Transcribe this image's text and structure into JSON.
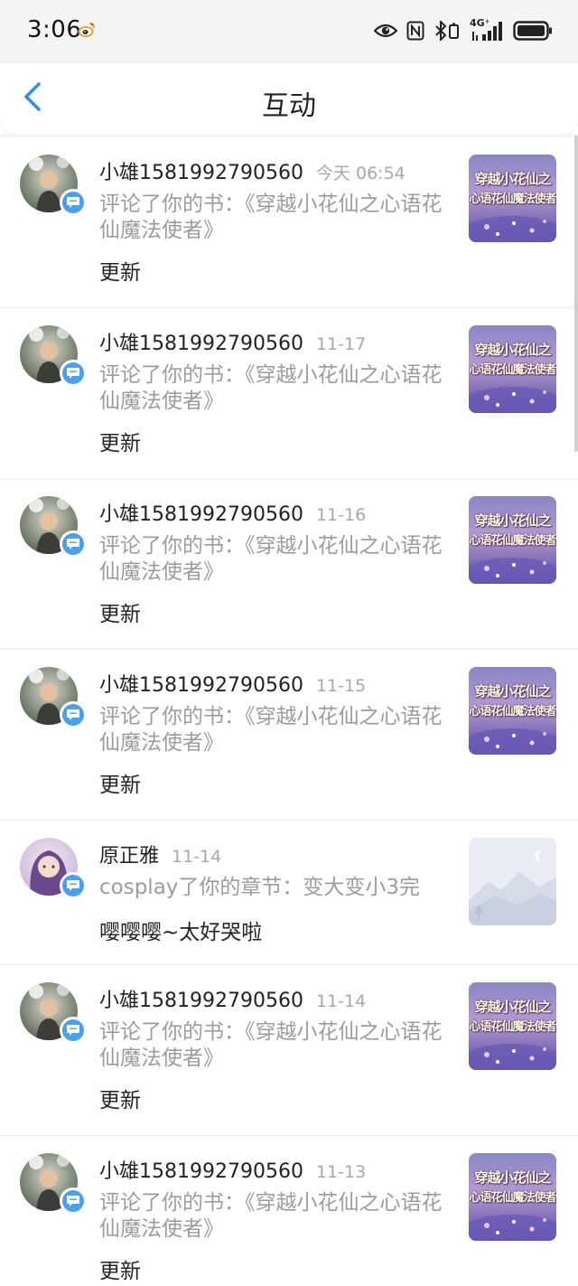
{
  "status_bar": {
    "time": "3:06",
    "network": "4G⁺"
  },
  "header": {
    "title": "互动"
  },
  "items": [
    {
      "name": "小雄1581992790560",
      "date": "今天 06:54",
      "text": "评论了你的书：《穿越小花仙之心语花仙魔法使者》",
      "reply": "更新",
      "thumb_title_1": "穿越小花仙之",
      "thumb_title_2": "心语花仙魔法使者"
    },
    {
      "name": "小雄1581992790560",
      "date": "11-17",
      "text": "评论了你的书：《穿越小花仙之心语花仙魔法使者》",
      "reply": "更新",
      "thumb_title_1": "穿越小花仙之",
      "thumb_title_2": "心语花仙魔法使者"
    },
    {
      "name": "小雄1581992790560",
      "date": "11-16",
      "text": "评论了你的书：《穿越小花仙之心语花仙魔法使者》",
      "reply": "更新",
      "thumb_title_1": "穿越小花仙之",
      "thumb_title_2": "心语花仙魔法使者"
    },
    {
      "name": "小雄1581992790560",
      "date": "11-15",
      "text": "评论了你的书：《穿越小花仙之心语花仙魔法使者》",
      "reply": "更新",
      "thumb_title_1": "穿越小花仙之",
      "thumb_title_2": "心语花仙魔法使者"
    },
    {
      "name": "原正雅",
      "date": "11-14",
      "text": "cosplay了你的章节：变大变小3完",
      "reply": "嘤嘤嘤~太好哭啦"
    },
    {
      "name": "小雄1581992790560",
      "date": "11-14",
      "text": "评论了你的书：《穿越小花仙之心语花仙魔法使者》",
      "reply": "更新",
      "thumb_title_1": "穿越小花仙之",
      "thumb_title_2": "心语花仙魔法使者"
    },
    {
      "name": "小雄1581992790560",
      "date": "11-13",
      "text": "评论了你的书：《穿越小花仙之心语花仙魔法使者》",
      "reply": "更新",
      "thumb_title_1": "穿越小花仙之",
      "thumb_title_2": "心语花仙魔法使者"
    }
  ],
  "colors": {
    "accent": "#2f8fe8",
    "badge": "#4aa0f0",
    "secondary_text": "#9c9c9c"
  },
  "icons": {
    "back": "chevron-left-icon",
    "badge": "comment-bubble-icon",
    "weibo": "weibo-icon",
    "eye": "eye-icon",
    "nfc": "nfc-icon",
    "bluetooth": "bluetooth-icon",
    "signal": "signal-icon",
    "battery": "battery-icon"
  }
}
